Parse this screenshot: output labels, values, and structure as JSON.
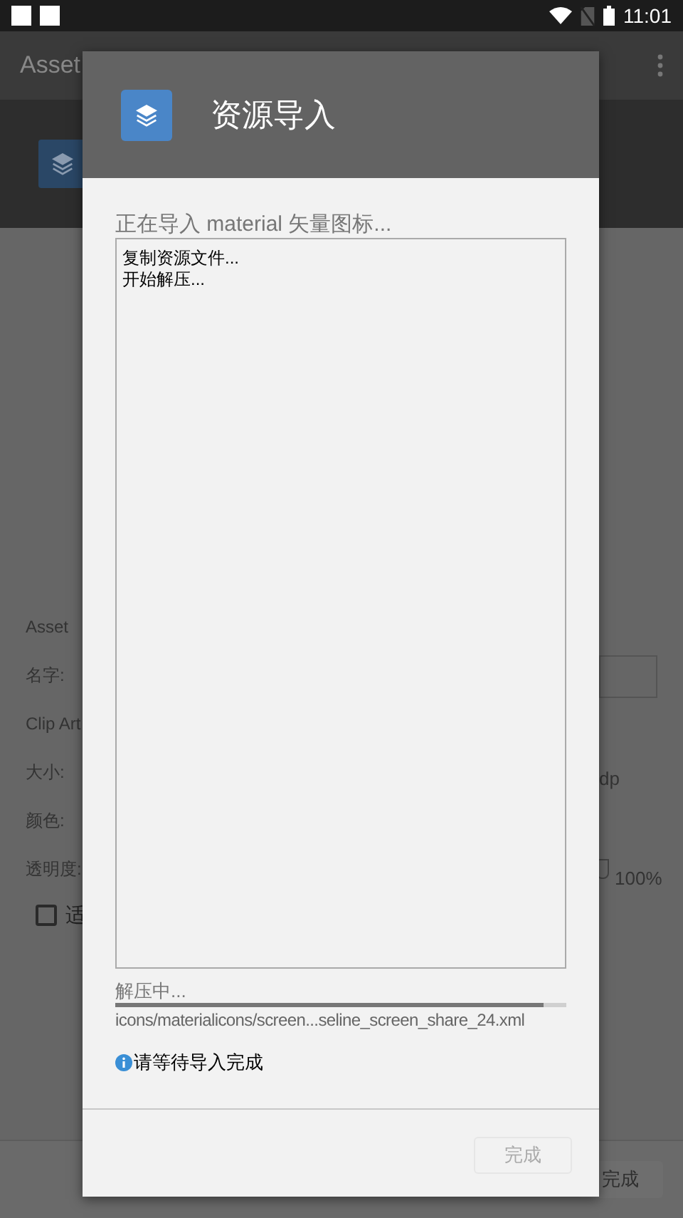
{
  "status_bar": {
    "time": "11:01"
  },
  "app_bar": {
    "title": "Asset"
  },
  "form": {
    "labels": [
      "Asset",
      "名字:",
      "Clip Art",
      "大小:",
      "颜色:",
      "透明度:"
    ],
    "size_unit": "dp",
    "opacity_value": "100%",
    "checkbox": {
      "label": "适",
      "checked": false
    },
    "finish_button": "完成"
  },
  "dialog": {
    "title": "资源导入",
    "heading": "正在导入 material 矢量图标...",
    "log": [
      "复制资源文件...",
      "开始解压..."
    ],
    "progress_label": "解压中...",
    "progress": {
      "level": 0.95
    },
    "current_file": "icons/materialicons/screen...seline_screen_share_24.xml",
    "info": "请等待导入完成",
    "button": {
      "label": "完成",
      "disabled": true
    }
  }
}
